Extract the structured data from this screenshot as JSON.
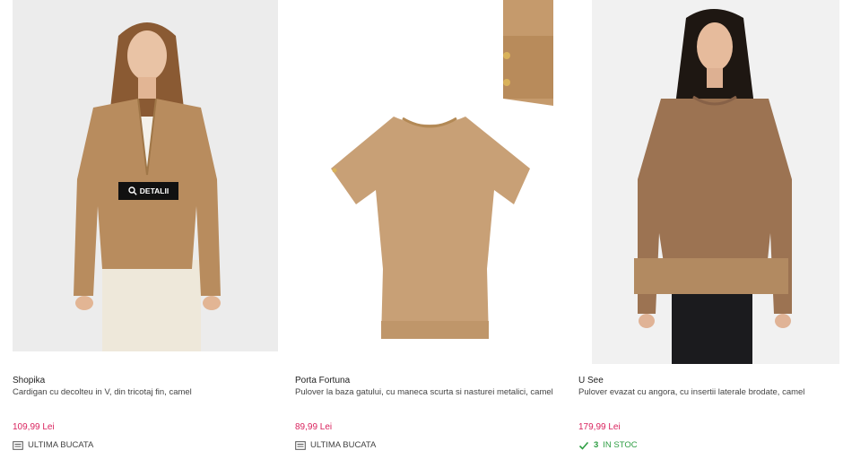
{
  "products": [
    {
      "brand": "Shopika",
      "description": "Cardigan cu decolteu in V, din tricotaj fin, camel",
      "price": "109,99 Lei",
      "stock_label": "ULTIMA BUCATA",
      "stock_icon": "box-icon",
      "hover_button": "DETALII"
    },
    {
      "brand": "Porta Fortuna",
      "description": "Pulover la baza gatului, cu maneca scurta si nasturei metalici, camel",
      "price": "89,99 Lei",
      "stock_label": "ULTIMA BUCATA",
      "stock_icon": "box-icon"
    },
    {
      "brand": "U See",
      "description": "Pulover evazat cu angora, cu insertii laterale brodate, camel",
      "price": "179,99 Lei",
      "stock_count": "3",
      "stock_label": "IN STOC",
      "stock_icon": "check-icon"
    }
  ],
  "colors": {
    "price": "#d9235e",
    "in_stock": "#2f9e44",
    "camel": "#c19a6b"
  }
}
